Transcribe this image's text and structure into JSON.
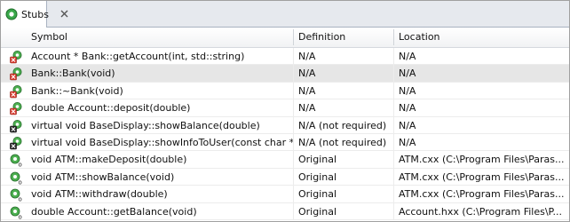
{
  "view": {
    "tab_label": "Stubs",
    "tab_icon": "stubs-view-icon",
    "close_icon": "close-icon"
  },
  "table": {
    "columns": [
      "Symbol",
      "Definition",
      "Location"
    ],
    "rows": [
      {
        "symbol": "Account * Bank::getAccount(int, std::string)",
        "definition": "N/A",
        "location": "N/A",
        "icon": "stub-missing-icon",
        "selected": false
      },
      {
        "symbol": "Bank::Bank(void)",
        "definition": "N/A",
        "location": "N/A",
        "icon": "stub-missing-icon",
        "selected": true
      },
      {
        "symbol": "Bank::~Bank(void)",
        "definition": "N/A",
        "location": "N/A",
        "icon": "stub-missing-icon",
        "selected": false
      },
      {
        "symbol": "double Account::deposit(double)",
        "definition": "N/A",
        "location": "N/A",
        "icon": "stub-missing-icon",
        "selected": false
      },
      {
        "symbol": "virtual void BaseDisplay::showBalance(double)",
        "definition": "N/A (not required)",
        "location": "N/A",
        "icon": "stub-not-required-icon",
        "selected": false
      },
      {
        "symbol": "virtual void BaseDisplay::showInfoToUser(const char *)",
        "definition": "N/A (not required)",
        "location": "N/A",
        "icon": "stub-not-required-icon",
        "selected": false
      },
      {
        "symbol": "void ATM::makeDeposit(double)",
        "definition": "Original",
        "location": "ATM.cxx  (C:\\Program Files\\Paras...",
        "icon": "stub-original-icon",
        "selected": false
      },
      {
        "symbol": "void ATM::showBalance(void)",
        "definition": "Original",
        "location": "ATM.cxx  (C:\\Program Files\\Paras...",
        "icon": "stub-original-icon",
        "selected": false
      },
      {
        "symbol": "void ATM::withdraw(double)",
        "definition": "Original",
        "location": "ATM.cxx  (C:\\Program Files\\Paras...",
        "icon": "stub-original-icon",
        "selected": false
      },
      {
        "symbol": "double Account::getBalance(void)",
        "definition": "Original",
        "location": "Account.hxx  (C:\\Program Files\\P...",
        "icon": "stub-original-icon",
        "selected": false
      }
    ]
  }
}
